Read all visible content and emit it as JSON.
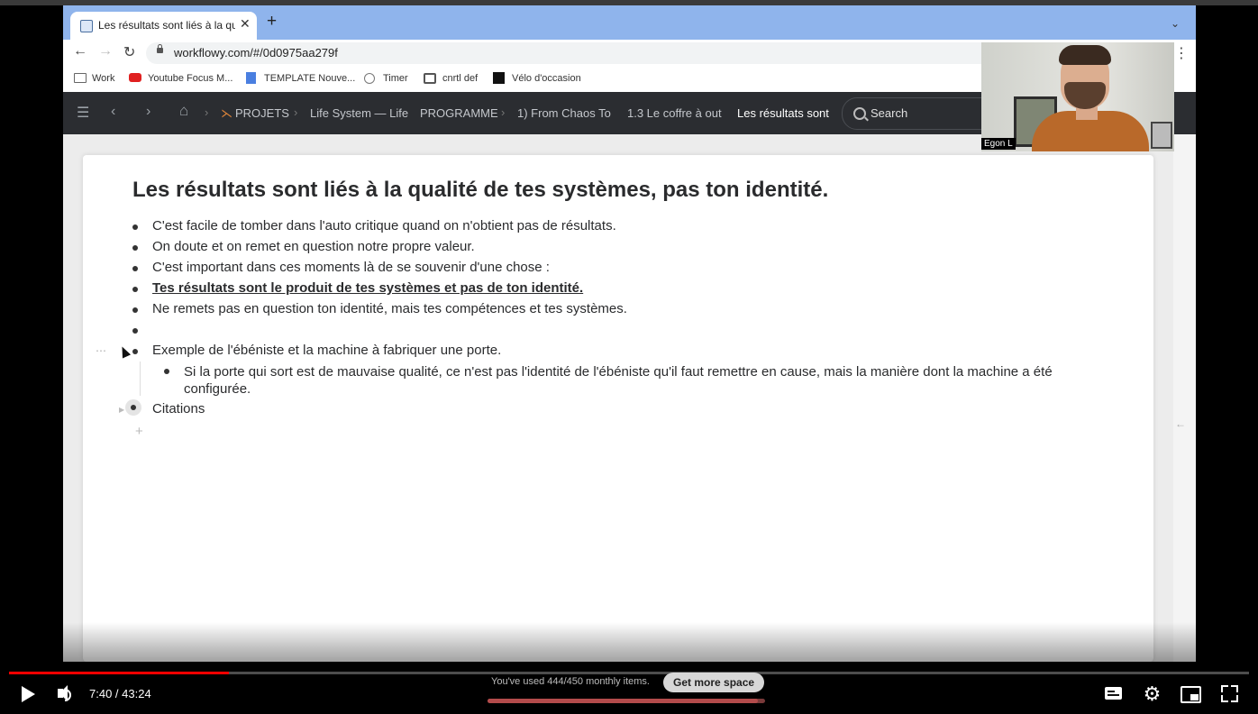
{
  "browser": {
    "tab_title": "Les résultats sont liés à la qualité de tes systèmes",
    "url": "workflowy.com/#/0d0975aa279f",
    "bookmarks": [
      {
        "label": "Work"
      },
      {
        "label": "Youtube Focus M..."
      },
      {
        "label": "TEMPLATE Nouve..."
      },
      {
        "label": "Timer"
      },
      {
        "label": "cnrtl def"
      },
      {
        "label": "Vélo d'occasion"
      }
    ]
  },
  "workflowy": {
    "breadcrumbs": [
      "PROJETS",
      "Life System — Life",
      "PROGRAMME",
      "1) From Chaos To",
      "1.3 Le coffre à out",
      "Les résultats sont"
    ],
    "search_placeholder": "Search",
    "document": {
      "title": "Les résultats sont liés à la qualité de tes systèmes, pas ton identité.",
      "items": [
        "C'est facile de tomber dans l'auto critique quand on n'obtient pas de résultats.",
        "On doute et on remet en question notre propre valeur.",
        "C'est important dans ces moments là de se souvenir d'une chose :",
        "Tes résultats sont le produit de tes systèmes et pas de ton identité.",
        "Ne remets pas en question ton identité, mais tes compétences et tes systèmes.",
        "",
        "Exemple de l'ébéniste et la machine à fabriquer une porte."
      ],
      "sub_item": "Si la porte qui sort est de mauvaise qualité, ce n'est pas l'identité de l'ébéniste qu'il faut remettre en cause, mais la manière dont la machine a été configurée.",
      "collapsed_item": "Citations",
      "add_symbol": "+"
    },
    "toast": {
      "message": "You've used 444/450 monthly items.",
      "button": "Get more space",
      "used": 444,
      "limit": 450
    }
  },
  "webcam": {
    "name": "Egon L"
  },
  "player": {
    "current_time": "7:40",
    "duration": "43:24",
    "time_display": "7:40 / 43:24",
    "progress": 0.177,
    "accent": "#ff0000"
  }
}
